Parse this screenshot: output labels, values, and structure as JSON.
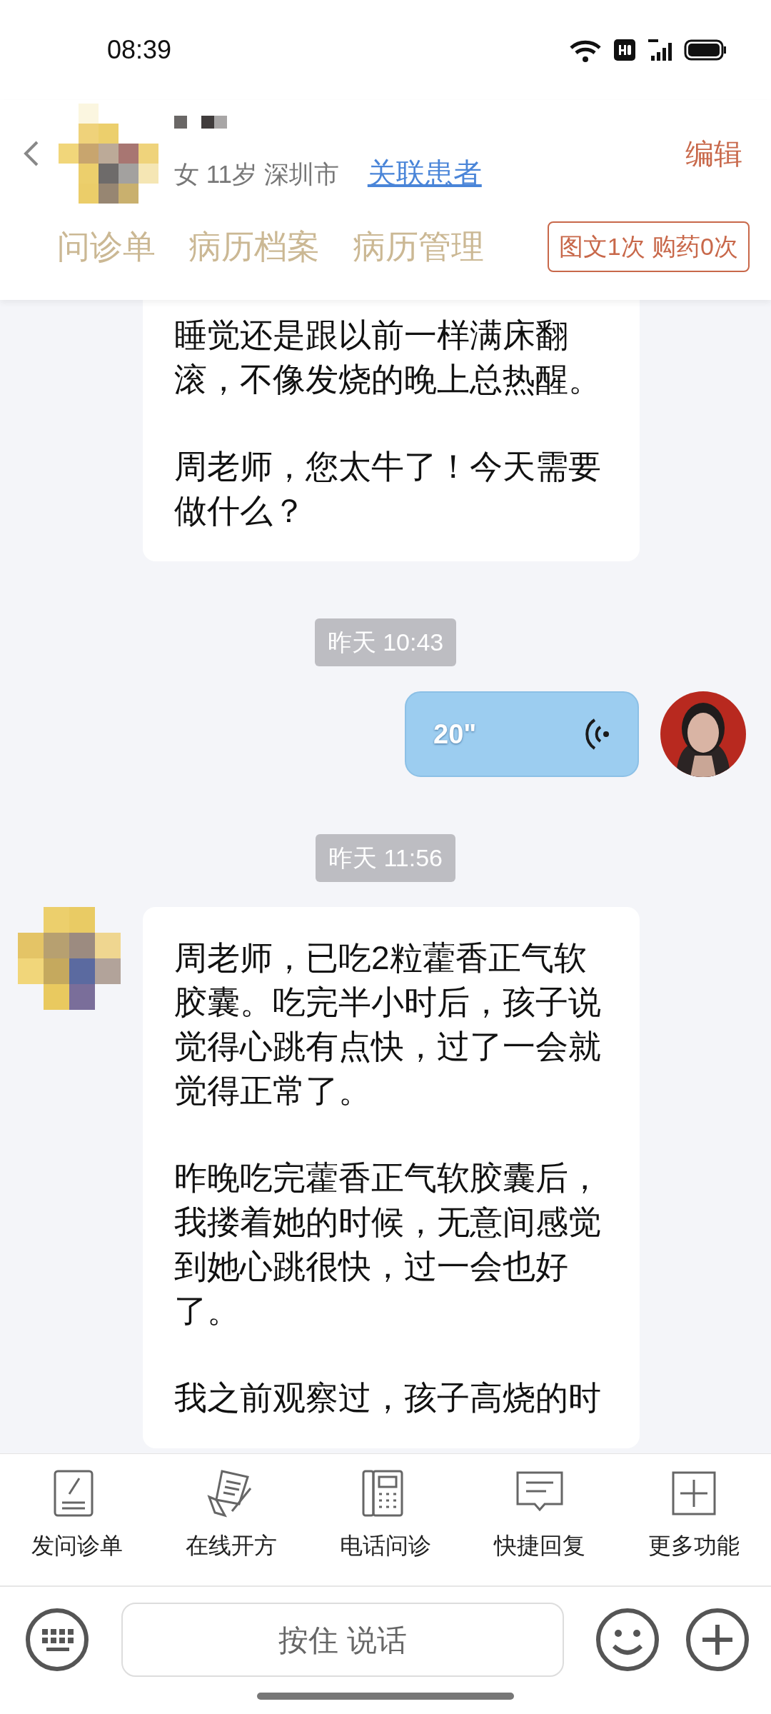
{
  "status_bar": {
    "time": "08:39"
  },
  "header": {
    "gender": "女",
    "age": "11岁",
    "city": "深圳市",
    "link": "关联患者",
    "edit": "编辑",
    "tabs": [
      {
        "label": "问诊单"
      },
      {
        "label": "病历档案"
      },
      {
        "label": "病历管理"
      }
    ],
    "usage_badge": "图文1次 购药0次"
  },
  "messages": [
    {
      "kind": "text",
      "outgoing": false,
      "avatar": false,
      "paragraphs": [
        "睡觉还是跟以前一样满床翻滚，不像发烧的晚上总热醒。",
        "周老师，您太牛了！今天需要做什么？"
      ]
    },
    {
      "kind": "time",
      "text": "昨天 10:43"
    },
    {
      "kind": "voice",
      "outgoing": true,
      "avatar": true,
      "duration": "20\""
    },
    {
      "kind": "time",
      "text": "昨天 11:56"
    },
    {
      "kind": "text",
      "outgoing": false,
      "avatar": true,
      "paragraphs": [
        "周老师，已吃2粒藿香正气软胶囊。吃完半小时后，孩子说觉得心跳有点快，过了一会就觉得正常了。",
        "昨晚吃完藿香正气软胶囊后，我搂着她的时候，无意间感觉到她心跳很快，过一会也好了。",
        "我之前观察过，孩子高烧的时"
      ]
    }
  ],
  "toolbar": [
    {
      "label": "发问诊单"
    },
    {
      "label": "在线开方"
    },
    {
      "label": "电话问诊"
    },
    {
      "label": "快捷回复"
    },
    {
      "label": "更多功能"
    }
  ],
  "input_bar": {
    "hold_to_talk": "按住 说话"
  }
}
